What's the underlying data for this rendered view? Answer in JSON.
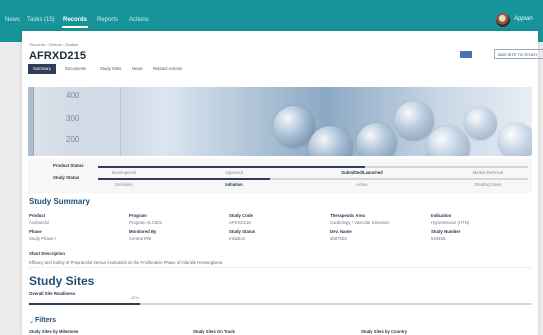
{
  "nav": {
    "items": [
      "News",
      "Tasks (15)",
      "Records",
      "Reports",
      "Actions"
    ],
    "brand": "Appian"
  },
  "page": {
    "breadcrumb": "Records › Clinical › Studies",
    "title": "AFRXD215",
    "add_site_label": "ADD SITE TO STUDY"
  },
  "tabs": [
    "Summary",
    "Documents",
    "Study Sites",
    "News",
    "Related Actions"
  ],
  "status": {
    "product_status_label": "Product Status",
    "study_status_label": "Study Status",
    "product_stages": [
      "Development",
      "Approved",
      "Submitted/Launched",
      "Market Removal"
    ],
    "study_stages": [
      "Definition",
      "Initiation",
      "Active",
      "Shutting Down"
    ],
    "product_progress": 0.62,
    "study_progress": 0.4
  },
  "summary": {
    "title": "Study Summary",
    "fields": [
      {
        "label": "Product",
        "value": "Acebutolol"
      },
      {
        "label": "Program",
        "value": "Program ALC501"
      },
      {
        "label": "Study Code",
        "value": "AFRXD215"
      },
      {
        "label": "Therapeutic Area",
        "value": "Cardiology / Vascular Diseases"
      },
      {
        "label": "Indication",
        "value": "Hypertension (HTN)"
      },
      {
        "label": "Phase",
        "value": "Study Phase I"
      },
      {
        "label": "Monitored By",
        "value": "Central IRB"
      },
      {
        "label": "Study Status",
        "value": "Initiation"
      },
      {
        "label": "Dev. Name",
        "value": "ab87003"
      },
      {
        "label": "Study Number",
        "value": "543456"
      }
    ],
    "short_description_label": "Short Description",
    "short_description": "Efficacy and Safety of Propranolol Versus Acebutolol on the Proliferative Phase of Infantile Hemangioma"
  },
  "sites": {
    "title": "Study Sites",
    "overall_label": "Overall Site Readiness",
    "readiness_pct": "22%",
    "readiness_value": 0.22,
    "filters_label": "Filters",
    "columns": [
      "Study Sites by Milestone",
      "Study Sites On Track",
      "Study Sites by Country"
    ]
  },
  "hero": {
    "scale_labels": [
      "400",
      "300",
      "200"
    ]
  },
  "colors": {
    "nav": "#17949a",
    "accent": "#2f3d59",
    "heading": "#1f4f78"
  }
}
